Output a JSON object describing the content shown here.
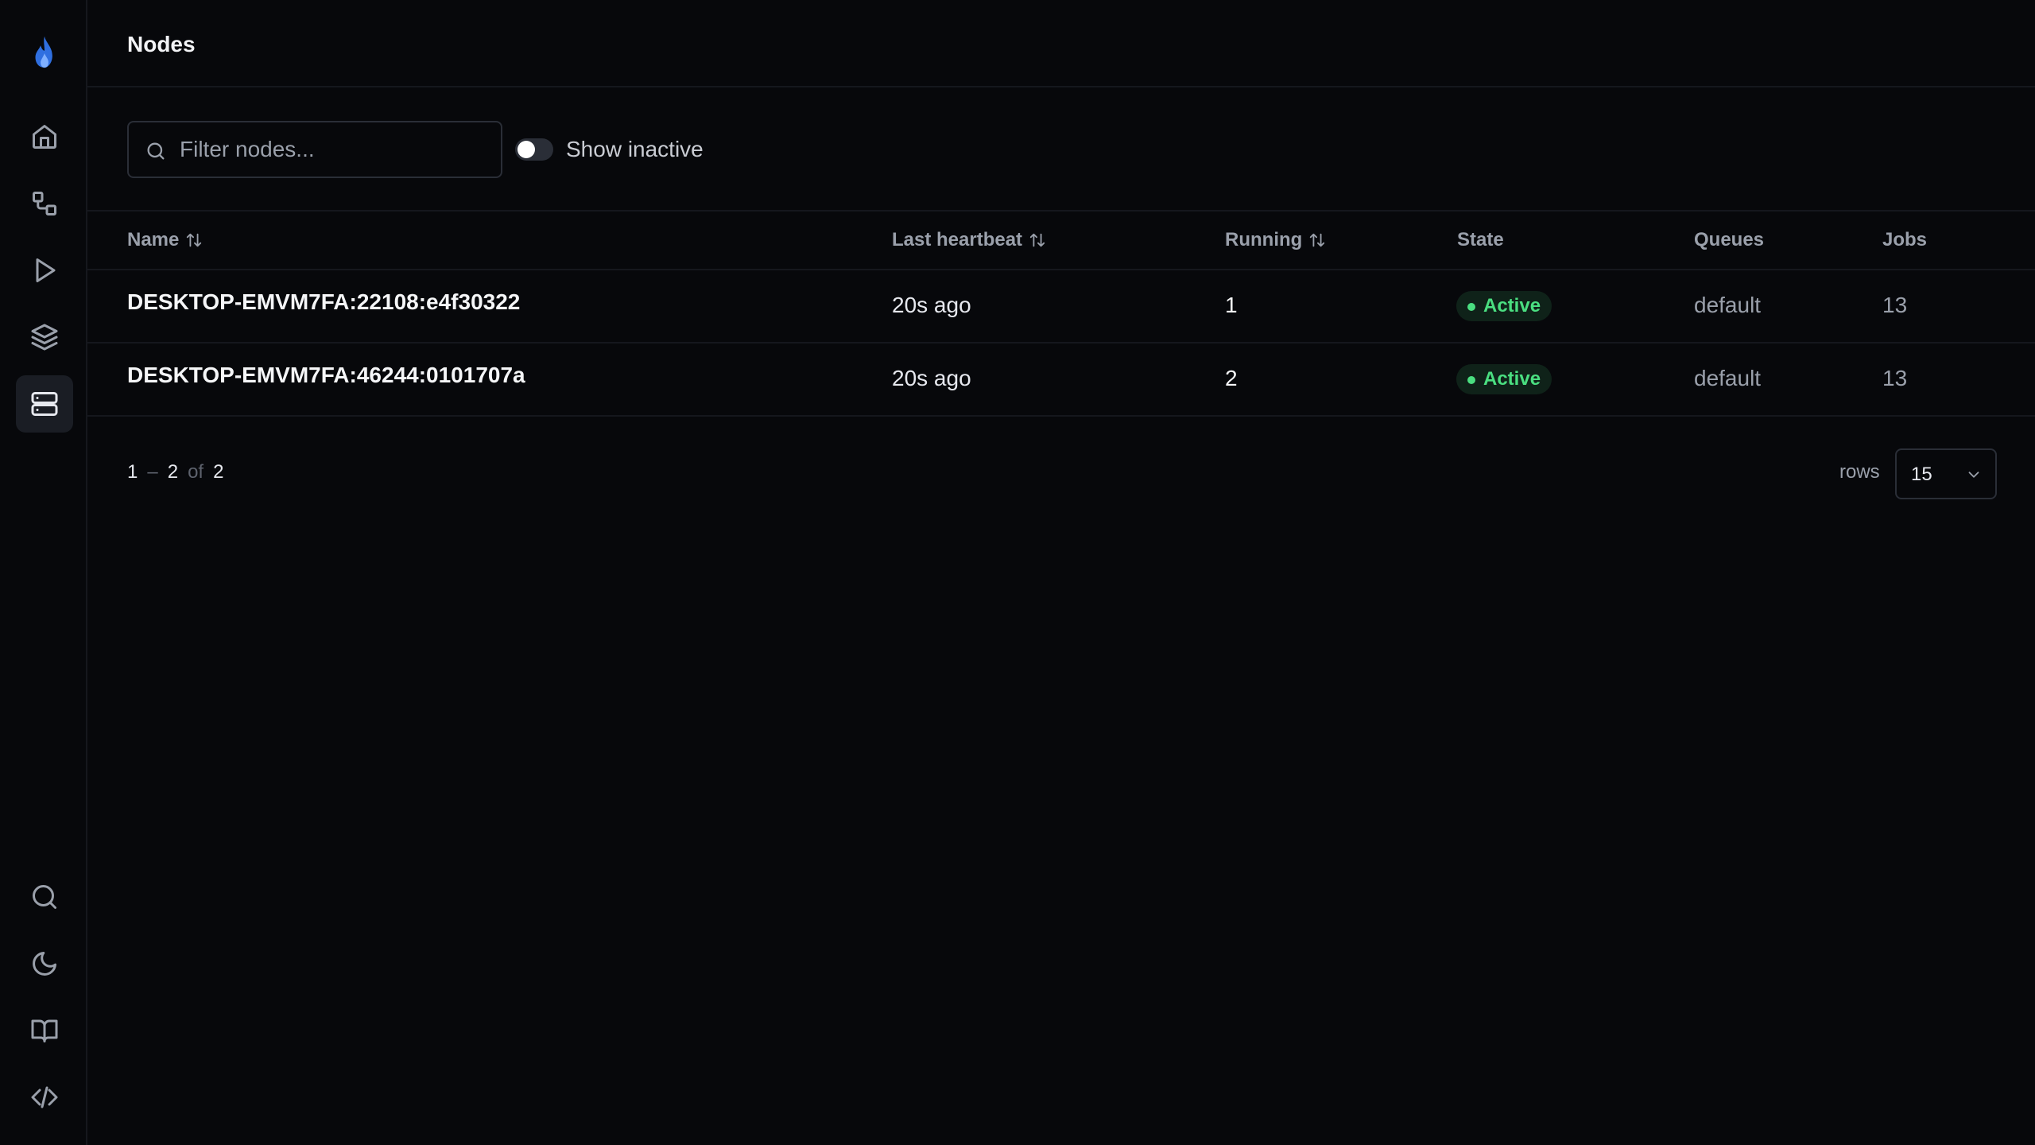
{
  "app": {
    "logo_icon": "flame-icon",
    "accent_color": "#3b82f6"
  },
  "sidebar": {
    "top_items": [
      {
        "name": "home",
        "icon": "home-icon",
        "active": false
      },
      {
        "name": "workflows",
        "icon": "workflow-icon",
        "active": false
      },
      {
        "name": "runs",
        "icon": "play-icon",
        "active": false
      },
      {
        "name": "queues",
        "icon": "layers-icon",
        "active": false
      },
      {
        "name": "nodes",
        "icon": "server-icon",
        "active": true
      }
    ],
    "bottom_items": [
      {
        "name": "search",
        "icon": "search-icon"
      },
      {
        "name": "theme",
        "icon": "moon-icon"
      },
      {
        "name": "docs",
        "icon": "book-icon"
      },
      {
        "name": "api",
        "icon": "code-icon"
      }
    ]
  },
  "header": {
    "title": "Nodes"
  },
  "toolbar": {
    "search_placeholder": "Filter nodes...",
    "search_value": "",
    "toggle_label": "Show inactive",
    "toggle_on": false
  },
  "table": {
    "columns": {
      "name": "Name",
      "heartbeat": "Last heartbeat",
      "running": "Running",
      "state": "State",
      "queues": "Queues",
      "jobs": "Jobs"
    },
    "rows": [
      {
        "name": "DESKTOP-EMVM7FA:22108:e4f30322",
        "heartbeat": "20s ago",
        "running": "1",
        "state": "Active",
        "queues": "default",
        "jobs": "13"
      },
      {
        "name": "DESKTOP-EMVM7FA:46244:0101707a",
        "heartbeat": "20s ago",
        "running": "2",
        "state": "Active",
        "queues": "default",
        "jobs": "13"
      }
    ]
  },
  "pagination": {
    "from": "1",
    "dash": "–",
    "to": "2",
    "of": "of",
    "total": "2",
    "rows_label": "rows",
    "rows_value": "15"
  },
  "colors": {
    "background": "#07080b",
    "active_badge": "#4ade80"
  }
}
